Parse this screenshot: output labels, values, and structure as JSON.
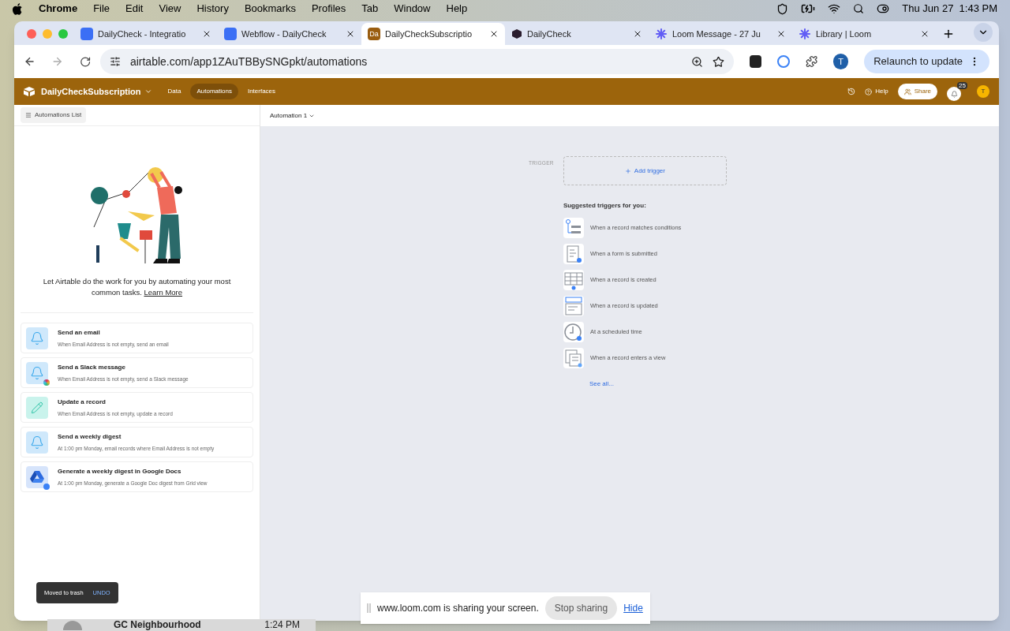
{
  "menubar": {
    "app": "Chrome",
    "menus": [
      "File",
      "Edit",
      "View",
      "History",
      "Bookmarks",
      "Profiles",
      "Tab",
      "Window",
      "Help"
    ],
    "clock": "Thu Jun 27  1:43 PM"
  },
  "browser": {
    "tabs": [
      {
        "title": "DailyCheck - Integratio",
        "kind": "square-w",
        "selected": false
      },
      {
        "title": "Webflow - DailyCheck",
        "kind": "square-w",
        "selected": false
      },
      {
        "title": "DailyCheckSubscriptio",
        "kind": "da",
        "icon_text": "Da",
        "selected": true
      },
      {
        "title": "DailyCheck",
        "kind": "cube",
        "selected": false
      },
      {
        "title": "Loom Message - 27 Ju",
        "kind": "loom",
        "selected": false
      },
      {
        "title": "Library | Loom",
        "kind": "loom",
        "selected": false
      }
    ],
    "url": "airtable.com/app1ZAuTBBySNGpkt/automations",
    "relaunch": "Relaunch to update",
    "profile": "T"
  },
  "app": {
    "base_name": "DailyCheckSubscription",
    "nav": [
      {
        "label": "Data",
        "selected": false
      },
      {
        "label": "Automations",
        "selected": true
      },
      {
        "label": "Interfaces",
        "selected": false
      }
    ],
    "help": "Help",
    "share": "Share",
    "notifications": "25",
    "avatar": "T",
    "automations_list": "Automations List",
    "automation_name": "Automation 1",
    "intro": "Let Airtable do the work for you by automating your most common tasks.",
    "learn_more": "Learn More",
    "templates": [
      {
        "title": "Send an email",
        "subtitle": "When Email Address is not empty, send an email",
        "kind": "bell"
      },
      {
        "title": "Send a Slack message",
        "subtitle": "When Email Address is not empty, send a Slack message",
        "kind": "bell-slack"
      },
      {
        "title": "Update a record",
        "subtitle": "When Email Address is not empty, update a record",
        "kind": "pencil"
      },
      {
        "title": "Send a weekly digest",
        "subtitle": "At 1:00 pm Monday, email records where Email Address is not empty",
        "kind": "bell"
      },
      {
        "title": "Generate a weekly digest in Google Docs",
        "subtitle": "At 1:00 pm Monday, generate a Google Doc digest from Grid view",
        "kind": "drive"
      }
    ],
    "toast": {
      "message": "Moved to trash",
      "action": "UNDO"
    },
    "trigger_label": "TRIGGER",
    "add_trigger": "Add trigger",
    "suggested_heading": "Suggested triggers for you:",
    "triggers": [
      {
        "label": "When a record matches conditions",
        "kind": "conditions"
      },
      {
        "label": "When a form is submitted",
        "kind": "form"
      },
      {
        "label": "When a record is created",
        "kind": "created"
      },
      {
        "label": "When a record is updated",
        "kind": "updated"
      },
      {
        "label": "At a scheduled time",
        "kind": "clock"
      },
      {
        "label": "When a record enters a view",
        "kind": "view"
      }
    ],
    "see_all": "See all..."
  },
  "sharing_bar": {
    "message": "www.loom.com is sharing your screen.",
    "stop": "Stop sharing",
    "hide": "Hide"
  },
  "background_window": {
    "title": "GC Neighbourhood",
    "time": "1:24 PM"
  }
}
